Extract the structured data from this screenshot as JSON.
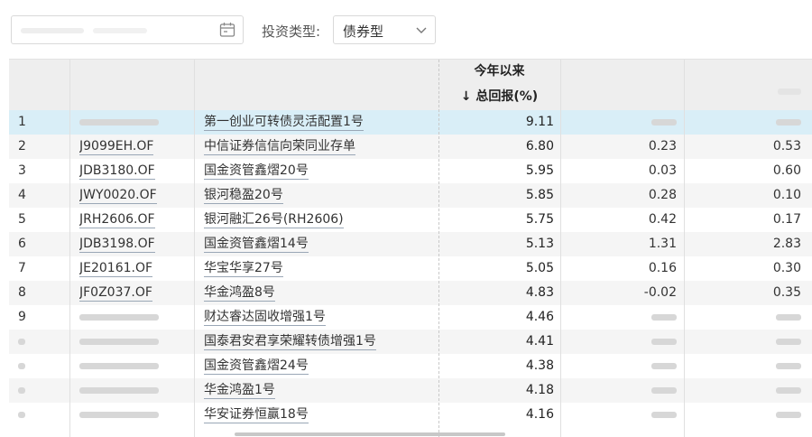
{
  "filter": {
    "type_label": "投资类型:",
    "type_value": "债券型"
  },
  "table": {
    "group_header": "今年以来",
    "sort_header": "↓ 总回报(%)",
    "rows": [
      {
        "idx": "1",
        "code": "",
        "name": "第一创业可转债灵活配置1号",
        "ret": "9.11",
        "v1": "",
        "v2": "",
        "selected": true
      },
      {
        "idx": "2",
        "code": "J9099EH.OF",
        "name": "中信证券信信向荣同业存单",
        "ret": "6.80",
        "v1": "0.23",
        "v2": "0.53"
      },
      {
        "idx": "3",
        "code": "JDB3180.OF",
        "name": "国金资管鑫熠20号",
        "ret": "5.95",
        "v1": "0.03",
        "v2": "0.60"
      },
      {
        "idx": "4",
        "code": "JWY0020.OF",
        "name": "银河稳盈20号",
        "ret": "5.85",
        "v1": "0.28",
        "v2": "0.10"
      },
      {
        "idx": "5",
        "code": "JRH2606.OF",
        "name": "银河融汇26号(RH2606)",
        "ret": "5.75",
        "v1": "0.42",
        "v2": "0.17"
      },
      {
        "idx": "6",
        "code": "JDB3198.OF",
        "name": "国金资管鑫熠14号",
        "ret": "5.13",
        "v1": "1.31",
        "v2": "2.83"
      },
      {
        "idx": "7",
        "code": "JE20161.OF",
        "name": "华宝华享27号",
        "ret": "5.05",
        "v1": "0.16",
        "v2": "0.30"
      },
      {
        "idx": "8",
        "code": "JF0Z037.OF",
        "name": "华金鸿盈8号",
        "ret": "4.83",
        "v1": "-0.02",
        "v2": "0.35"
      },
      {
        "idx": "9",
        "code": "",
        "name": "财达睿达固收增强1号",
        "ret": "4.46",
        "v1": "",
        "v2": ""
      },
      {
        "idx": "",
        "code": "",
        "name": "国泰君安君享荣耀转债增强1号",
        "ret": "4.41",
        "v1": "",
        "v2": ""
      },
      {
        "idx": "",
        "code": "",
        "name": "国金资管鑫熠24号",
        "ret": "4.38",
        "v1": "",
        "v2": ""
      },
      {
        "idx": "",
        "code": "",
        "name": "华金鸿盈1号",
        "ret": "4.18",
        "v1": "",
        "v2": ""
      },
      {
        "idx": "",
        "code": "",
        "name": "华安证券恒赢18号",
        "ret": "4.16",
        "v1": "",
        "v2": ""
      }
    ]
  },
  "icons": {
    "calendar": "calendar-icon",
    "dropdown": "chevron-down-icon"
  }
}
